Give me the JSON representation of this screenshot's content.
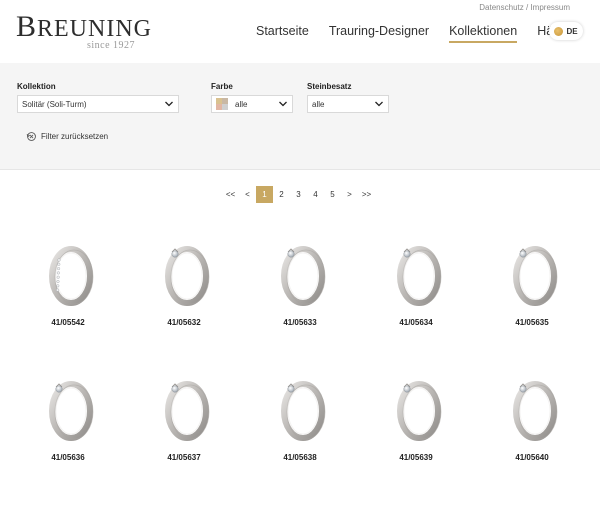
{
  "meta_links": {
    "privacy": "Datenschutz",
    "separator": "/",
    "imprint": "Impressum"
  },
  "logo": {
    "initial": "B",
    "rest": "REUNING",
    "tagline": "since 1927"
  },
  "nav": {
    "items": [
      {
        "label": "Startseite",
        "active": false
      },
      {
        "label": "Trauring-Designer",
        "active": false
      },
      {
        "label": "Kollektionen",
        "active": true
      },
      {
        "label": "Händler",
        "active": false
      }
    ],
    "language": "DE"
  },
  "filters": {
    "collection": {
      "label": "Kollektion",
      "value": "Solitär (Soli-Turm)"
    },
    "color": {
      "label": "Farbe",
      "value": "alle"
    },
    "stones": {
      "label": "Steinbesatz",
      "value": "alle"
    },
    "reset_label": "Filter zurücksetzen"
  },
  "pagination": {
    "first": "<<",
    "prev": "<",
    "pages": [
      "1",
      "2",
      "3",
      "4",
      "5"
    ],
    "current": "1",
    "next": ">",
    "last": ">>"
  },
  "products": [
    {
      "code": "41/05542",
      "variant": "band"
    },
    {
      "code": "41/05632",
      "variant": "solitaire"
    },
    {
      "code": "41/05633",
      "variant": "solitaire"
    },
    {
      "code": "41/05634",
      "variant": "solitaire"
    },
    {
      "code": "41/05635",
      "variant": "solitaire"
    },
    {
      "code": "41/05636",
      "variant": "solitaire"
    },
    {
      "code": "41/05637",
      "variant": "solitaire"
    },
    {
      "code": "41/05638",
      "variant": "solitaire"
    },
    {
      "code": "41/05639",
      "variant": "solitaire"
    },
    {
      "code": "41/05640",
      "variant": "solitaire"
    }
  ],
  "colors": {
    "accent": "#c8a862",
    "panel": "#f5f5f5",
    "ring_metal": "#b9b6b3"
  }
}
